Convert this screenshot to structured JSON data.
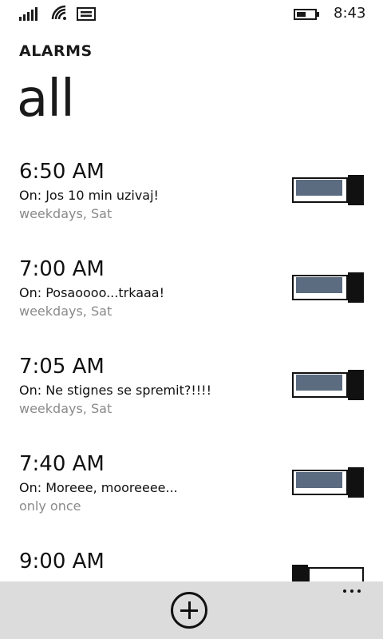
{
  "status": {
    "time": "8:43",
    "icons": [
      "signal-icon",
      "wifi-icon",
      "message-icon",
      "battery-icon"
    ]
  },
  "app": {
    "title": "ALARMS",
    "pivot": "all"
  },
  "alarms": [
    {
      "time": "6:50 AM",
      "label": "On:  Jos 10 min uzivaj!",
      "days": "weekdays, Sat",
      "enabled": true
    },
    {
      "time": "7:00 AM",
      "label": "On:  Posaoooo...trkaaa!",
      "days": "weekdays, Sat",
      "enabled": true
    },
    {
      "time": "7:05 AM",
      "label": "On:  Ne stignes se spremit?!!!!",
      "days": "weekdays, Sat",
      "enabled": true
    },
    {
      "time": "7:40 AM",
      "label": "On:  Moreee, mooreeee...",
      "days": "only once",
      "enabled": true
    },
    {
      "time": "9:00 AM",
      "label": "",
      "days": "",
      "enabled": false
    }
  ],
  "appbar": {
    "buttons": [
      "add-icon"
    ],
    "more": "more-icon"
  },
  "colors": {
    "toggle_fill": "#5b6b80",
    "appbar_bg": "#dcdcdc",
    "secondary_text": "#8a8a8a"
  }
}
